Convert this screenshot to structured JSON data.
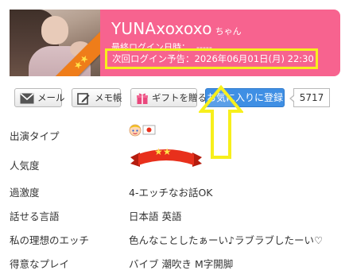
{
  "profile": {
    "name": "YUNAxoxoxo",
    "honorific": "ちゃん",
    "last_login_label": "最終ログイン日時：",
    "last_login_value": "-----",
    "next_login_text": "次回ログイン予告：2026年06月01日(月) 22:30",
    "rank_badge": "★★"
  },
  "actions": {
    "mail_label": "メール",
    "memo_label": "メモ帳",
    "gift_label": "ギフトを贈る",
    "favorite_label": "お気に入りに登録",
    "favorite_count": "5717"
  },
  "details": {
    "appearance_type": {
      "label": "出演タイプ"
    },
    "popularity": {
      "label": "人気度",
      "stars": "★★"
    },
    "intensity": {
      "label": "過激度",
      "value": "4-エッチなお話OK"
    },
    "languages": {
      "label": "話せる言語",
      "value": "日本語 英語"
    },
    "ideal": {
      "label": "私の理想のエッチ",
      "value": "色んなことしたぁーい♪ラブラブしたーい♡"
    },
    "play": {
      "label": "得意なプレイ",
      "value": "バイブ 潮吹き M字開脚"
    }
  },
  "colors": {
    "header_pink": "#f7638f",
    "highlight_yellow": "#f7ef1c",
    "favorite_blue": "#3f8fe4",
    "popularity_red": "#e8301c"
  },
  "icons": [
    "envelope-icon",
    "memo-pencil-icon",
    "gift-icon",
    "costume-type-icon",
    "japan-flag-icon",
    "popularity-ribbon-icon",
    "arrow-up-icon"
  ]
}
